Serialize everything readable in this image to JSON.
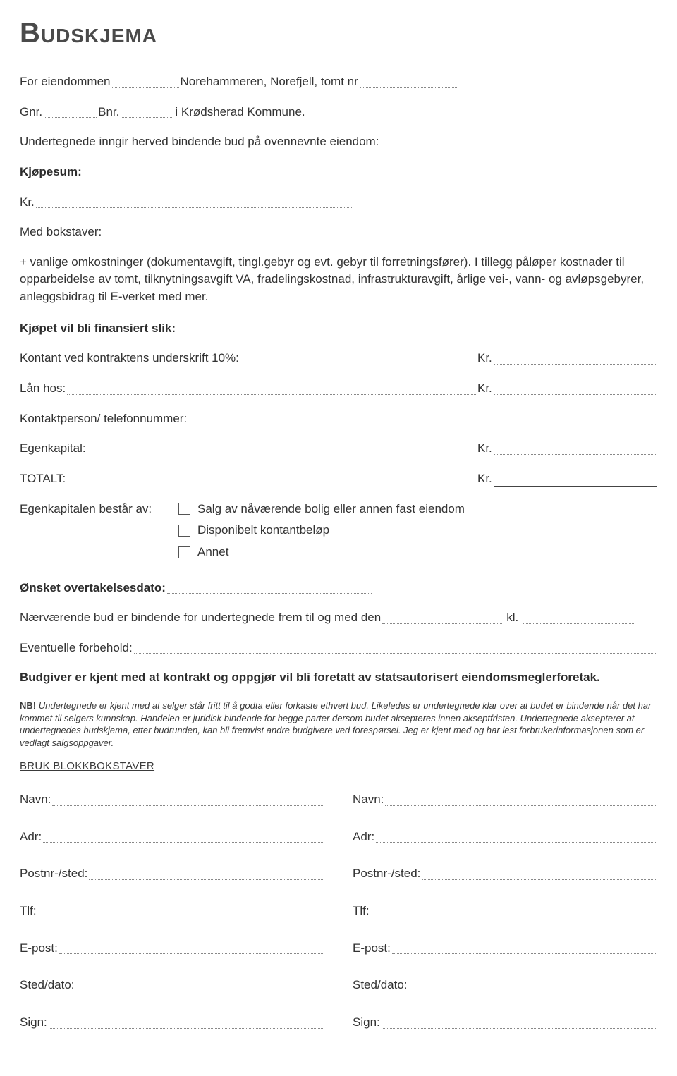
{
  "title": "Budskjema",
  "intro": {
    "for_property": "For eiendommen",
    "project": "Norehammeren, Norefjell, tomt nr",
    "gnr": "Gnr.",
    "bnr": "Bnr.",
    "municipality": "i Krødsherad Kommune.",
    "binding_bid": "Undertegnede inngir herved bindende bud på ovennevnte eiendom:",
    "purchase_sum_label": "Kjøpesum:",
    "kr": "Kr.",
    "in_letters": "Med bokstaver:",
    "plus_costs": "+ vanlige omkostninger (dokumentavgift, tingl.gebyr og evt. gebyr til forretningsfører). I tillegg påløper kostnader til opparbeidelse av tomt, tilknytningsavgift VA, fradelingskostnad, infrastrukturavgift, årlige vei-, vann- og avløpsgebyrer, anleggsbidrag til E-verket med mer."
  },
  "financing": {
    "heading": "Kjøpet vil bli finansiert slik:",
    "cash_at_sign": "Kontant ved kontraktens underskrift 10%:",
    "loan_from": "Lån hos:",
    "contact_person": "Kontaktperson/ telefonnummer:",
    "own_capital": "Egenkapital:",
    "total": "TOTALT:",
    "kr": "Kr.",
    "own_capital_consists": "Egenkapitalen består av:",
    "opt_sale": "Salg av nåværende bolig eller annen fast eiendom",
    "opt_cash": "Disponibelt kontantbeløp",
    "opt_other": "Annet"
  },
  "takeover": {
    "desired_date": "Ønsket overtakelsesdato:",
    "valid_until": "Nærværende bud er bindende for undertegnede frem til og med den",
    "kl": "kl.",
    "reservations": "Eventuelle forbehold:",
    "broker_notice": "Budgiver er kjent med at kontrakt og oppgjør vil bli foretatt av statsautorisert eiendomsmeglerforetak.",
    "nb_label": "NB!",
    "nb_text": "Undertegnede er kjent med at selger står fritt til å godta eller forkaste ethvert bud. Likeledes er undertegnede klar over at budet er bindende når det har kommet til selgers kunnskap. Handelen er juridisk bindende for begge parter dersom budet aksepteres innen akseptfristen. Undertegnede aksepterer at undertegnedes budskjema, etter budrunden, kan bli fremvist andre budgivere ved forespørsel. Jeg er kjent med og har lest forbrukerinformasjonen som er vedlagt salgsoppgaver."
  },
  "signature": {
    "block_letters": "BRUK BLOKKBOKSTAVER",
    "name": "Navn:",
    "addr": "Adr:",
    "postnr": "Postnr-/sted:",
    "tlf": "Tlf:",
    "epost": "E-post:",
    "sted_dato": "Sted/dato:",
    "sign": "Sign:"
  }
}
